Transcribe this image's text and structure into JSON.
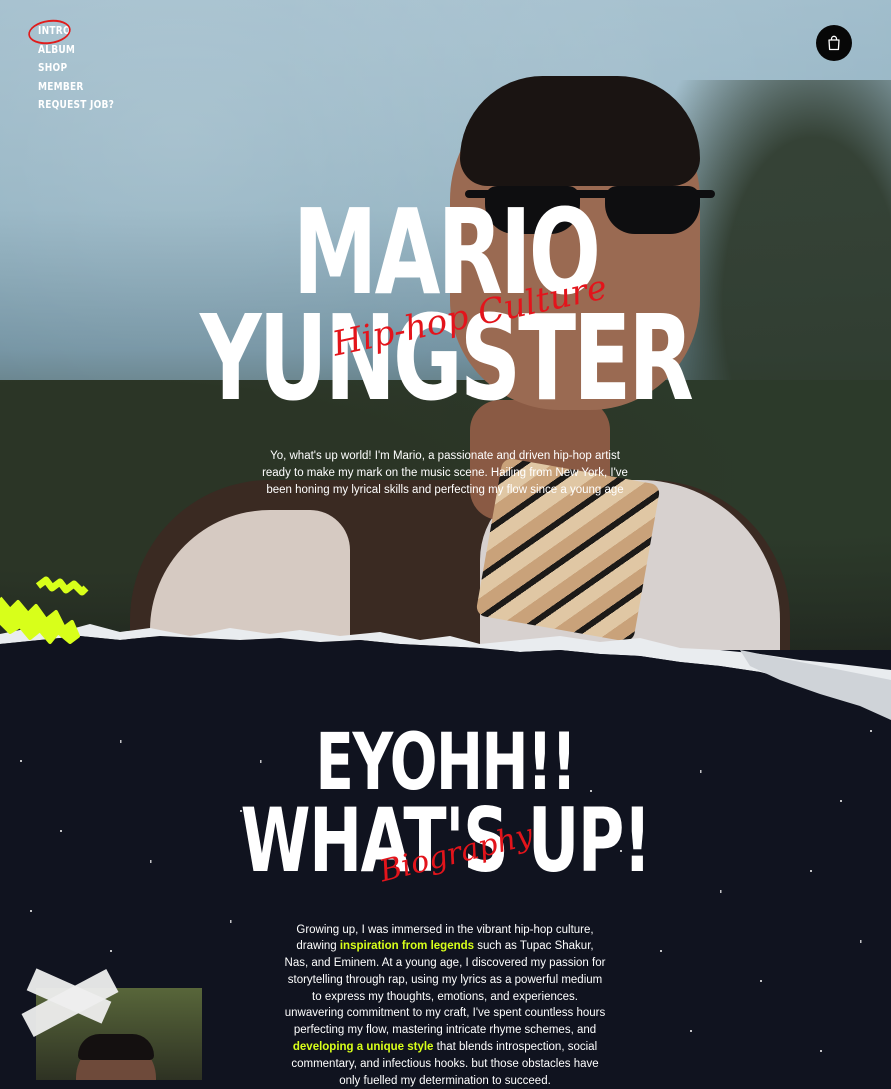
{
  "nav": {
    "items": [
      "INTRO",
      "ALBUM",
      "SHOP",
      "MEMBER",
      "REQUEST JOB?"
    ],
    "active_color": "#e01b1b"
  },
  "cart": {
    "icon": "shopping-bag-icon"
  },
  "hero": {
    "title_line1": "MARIO",
    "title_line2": "YUNGSTER",
    "script": "Hip-hop Culture",
    "description": "Yo, what's up world! I'm Mario, a passionate and driven hip-hop artist ready to make my mark on the music scene. Hailing from New York, I've been honing my lyrical skills and perfecting my flow since a young age"
  },
  "bio": {
    "title_line1": "EYOHH!!",
    "title_line2": "WHAT'S UP!",
    "script": "Biography",
    "p1": "Growing up, I was immersed in the vibrant hip-hop culture, drawing ",
    "h1": "inspiration from legends",
    "p2": " such as Tupac Shakur, Nas, and Eminem. At a young age, I discovered my passion for storytelling through rap, using my lyrics as a powerful medium to express my thoughts, emotions, and experiences. unwavering commitment to my craft, I've spent countless hours perfecting my flow, mastering intricate rhyme schemes, and ",
    "h2": "developing a unique style",
    "p3": " that blends introspection, social commentary, and infectious hooks. but those obstacles have only fuelled my determination to succeed."
  },
  "colors": {
    "accent_red": "#e3141b",
    "highlight_lime": "#d8ff1a",
    "dark_bg": "#10131f"
  }
}
